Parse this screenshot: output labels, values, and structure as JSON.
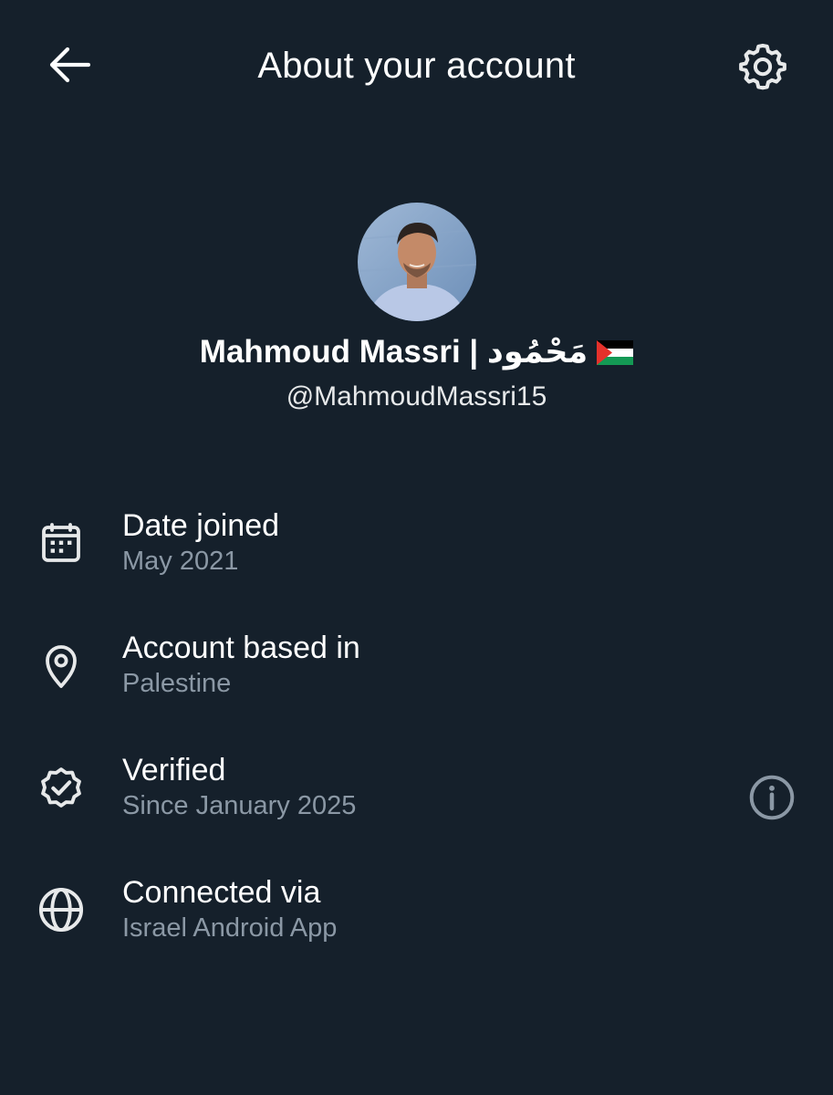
{
  "header": {
    "title": "About your account",
    "back_icon": "arrow-left-icon",
    "settings_icon": "gear-icon"
  },
  "profile": {
    "display_name": "Mahmoud Massri | مَحْمُود",
    "flag_icon": "palestine-flag-icon",
    "handle": "@MahmoudMassri15"
  },
  "rows": [
    {
      "icon": "calendar-icon",
      "title": "Date joined",
      "subtitle": "May 2021"
    },
    {
      "icon": "location-pin-icon",
      "title": "Account based in",
      "subtitle": "Palestine"
    },
    {
      "icon": "verified-badge-icon",
      "title": "Verified",
      "subtitle": "Since January 2025",
      "trailing_icon": "info-icon"
    },
    {
      "icon": "globe-icon",
      "title": "Connected via",
      "subtitle": "Israel Android App"
    }
  ],
  "colors": {
    "background": "#15202b",
    "primary_text": "#ffffff",
    "secondary_text": "#8b98a5",
    "icon": "#e7e9ea"
  }
}
